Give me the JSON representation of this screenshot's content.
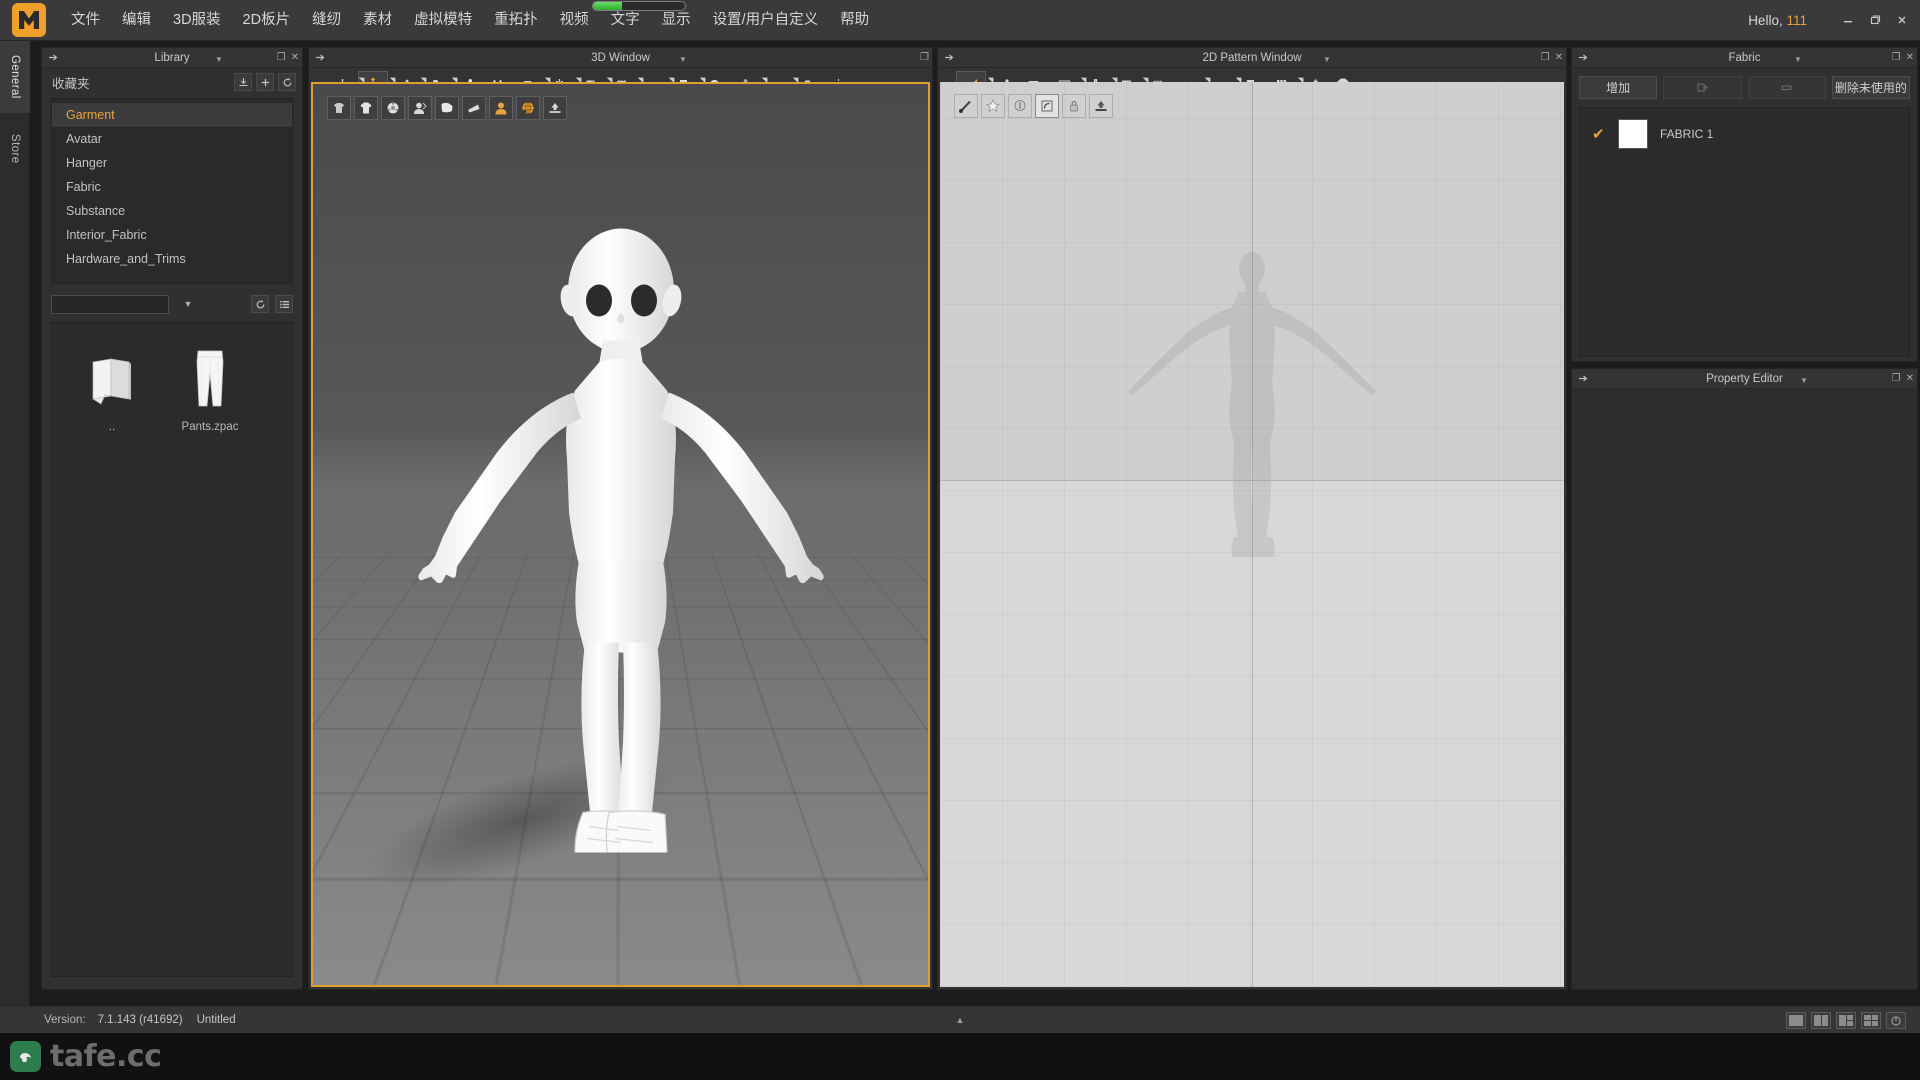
{
  "app": {
    "logo_icon": "marvelous-designer-logo",
    "greeting_label": "Hello,",
    "username": "111",
    "progress_percent": 31
  },
  "menubar": {
    "items": [
      {
        "label": "文件",
        "name": "menu-file"
      },
      {
        "label": "编辑",
        "name": "menu-edit"
      },
      {
        "label": "3D服装",
        "name": "menu-3d-garment"
      },
      {
        "label": "2D板片",
        "name": "menu-2d-pattern"
      },
      {
        "label": "缝纫",
        "name": "menu-sewing"
      },
      {
        "label": "素材",
        "name": "menu-material"
      },
      {
        "label": "虚拟模特",
        "name": "menu-avatar"
      },
      {
        "label": "重拓扑",
        "name": "menu-retopology"
      },
      {
        "label": "视频",
        "name": "menu-video"
      },
      {
        "label": "文字",
        "name": "menu-text"
      },
      {
        "label": "显示",
        "name": "menu-display"
      },
      {
        "label": "设置/用户自定义",
        "name": "menu-settings"
      },
      {
        "label": "帮助",
        "name": "menu-help"
      }
    ],
    "window_buttons": [
      "minimize",
      "restore",
      "close"
    ]
  },
  "vertical_tabs": [
    {
      "label": "General",
      "active": true
    },
    {
      "label": "Store",
      "active": false
    }
  ],
  "library": {
    "title": "Library",
    "favorites_label": "收藏夹",
    "header_icons": [
      "import-icon",
      "add-icon",
      "refresh-icon"
    ],
    "categories": [
      {
        "label": "Garment",
        "selected": true
      },
      {
        "label": "Avatar",
        "selected": false
      },
      {
        "label": "Hanger",
        "selected": false
      },
      {
        "label": "Fabric",
        "selected": false
      },
      {
        "label": "Substance",
        "selected": false
      },
      {
        "label": "Interior_Fabric",
        "selected": false
      },
      {
        "label": "Hardware_and_Trims",
        "selected": false
      }
    ],
    "search_value": "",
    "search_placeholder": "",
    "toolbar_icons": [
      "refresh-icon",
      "list-view-icon"
    ],
    "files": [
      {
        "caption": "..",
        "icon": "folder-up-icon"
      },
      {
        "caption": "Pants.zpac",
        "icon": "pants-thumbnail"
      }
    ]
  },
  "window3d": {
    "title": "3D Window",
    "toolbar": [
      {
        "name": "select-mesh-tool",
        "icon": "arrow-down",
        "active": false
      },
      {
        "name": "transform-tool",
        "icon": "move-gizmo",
        "active": true
      },
      {
        "name": "edit-pattern-tool",
        "icon": "pen-edit",
        "active": false
      },
      {
        "name": "pin-tool",
        "icon": "pin",
        "active": false
      },
      {
        "name": "tape-measure-tool",
        "icon": "measure",
        "active": false
      },
      {
        "name": "fold-arrange-tool",
        "icon": "double-arrow-up",
        "active": false
      },
      {
        "name": "flip-tool",
        "icon": "flip",
        "active": false
      },
      {
        "name": "zipper-tool",
        "icon": "zipper",
        "active": false
      },
      {
        "name": "fabric-tool",
        "icon": "fabric-swatch",
        "active": false
      },
      {
        "name": "grid-tool",
        "icon": "grid",
        "active": false
      },
      {
        "name": "stitch-tool",
        "icon": "stitch",
        "active": false
      },
      {
        "name": "puckering-tool",
        "icon": "puckering",
        "active": false
      },
      {
        "name": "button-tool",
        "icon": "button-circle",
        "active": false
      },
      {
        "name": "zipper2-tool",
        "icon": "zipper-vertical",
        "active": false
      },
      {
        "name": "attach-tool",
        "icon": "attach",
        "active": false
      },
      {
        "name": "graphic-tool",
        "icon": "graphic",
        "active": false
      },
      {
        "name": "symmetric-tool",
        "icon": "symmetry",
        "active": false
      }
    ],
    "overlay_toolbar": [
      {
        "name": "show-garment-toggle",
        "icon": "garment-icon",
        "accent": false
      },
      {
        "name": "show-texture-toggle",
        "icon": "tshirt-icon",
        "accent": false
      },
      {
        "name": "show-stitch-toggle",
        "icon": "gear-ball-icon",
        "accent": false
      },
      {
        "name": "show-avatar-toggle",
        "icon": "avatar-bust-icon",
        "accent": false
      },
      {
        "name": "show-pattern-toggle",
        "icon": "pattern-icon",
        "accent": false
      },
      {
        "name": "show-shade-toggle",
        "icon": "shade-icon",
        "accent": false
      },
      {
        "name": "avatar-head-toggle",
        "icon": "avatar-head-icon",
        "accent": true
      },
      {
        "name": "environment-toggle",
        "icon": "globe-icon",
        "accent": true
      },
      {
        "name": "export-snapshot",
        "icon": "upload-icon",
        "accent": false
      }
    ]
  },
  "window2d": {
    "title": "2D Pattern Window",
    "toolbar": [
      {
        "name": "edit-pattern-tool",
        "icon": "triangle-select",
        "active": true
      },
      {
        "name": "edit-curve-tool",
        "icon": "curve-point",
        "active": false
      },
      {
        "name": "rectangle-tool",
        "icon": "rectangle",
        "active": false
      },
      {
        "name": "polygon-tool",
        "icon": "polygon",
        "active": false
      },
      {
        "name": "pleat-tool",
        "icon": "pleat",
        "active": false
      },
      {
        "name": "internal-line-tool",
        "icon": "internal-line",
        "active": false
      },
      {
        "name": "grid-tool",
        "icon": "grid",
        "active": false
      },
      {
        "name": "dart-tool",
        "icon": "dart",
        "active": false
      },
      {
        "name": "sew-tool",
        "icon": "sew",
        "active": false
      },
      {
        "name": "puckering-tool",
        "icon": "puckering",
        "active": false
      },
      {
        "name": "pleat-fold-tool",
        "icon": "pleat-fold",
        "active": false
      },
      {
        "name": "trim-tool",
        "icon": "pencil-trim",
        "active": false
      },
      {
        "name": "garment-tool",
        "icon": "tshirt-icon",
        "active": false
      }
    ],
    "overlay_toolbar": [
      {
        "name": "pen-tool",
        "icon": "pen-icon"
      },
      {
        "name": "star-tool",
        "icon": "star-icon"
      },
      {
        "name": "circle-tool",
        "icon": "circle-icon"
      },
      {
        "name": "square-select-tool",
        "icon": "square-icon",
        "selected": true
      },
      {
        "name": "lock-tool",
        "icon": "lock-icon"
      },
      {
        "name": "export-tool",
        "icon": "upload-icon"
      }
    ]
  },
  "fabric_panel": {
    "title": "Fabric",
    "buttons": [
      {
        "label": "增加",
        "name": "add-fabric-button",
        "disabled": false
      },
      {
        "label": "",
        "name": "duplicate-fabric-button",
        "icon": "copy-icon",
        "disabled": true
      },
      {
        "label": "",
        "name": "rename-fabric-button",
        "icon": "rename-icon",
        "disabled": true
      },
      {
        "label": "删除未使用的",
        "name": "delete-unused-button",
        "disabled": false
      }
    ],
    "items": [
      {
        "name": "FABRIC 1",
        "checked": true,
        "swatch_color": "#ffffff"
      }
    ],
    "accent_color": "#e8a33d"
  },
  "property_editor": {
    "title": "Property Editor"
  },
  "statusbar": {
    "version_label": "Version:",
    "version_value": "7.1.143 (r41692)",
    "document_name": "Untitled",
    "collapse_icon": "chevron-up-icon",
    "layout_presets": [
      {
        "name": "layout-single",
        "cells": 1
      },
      {
        "name": "layout-two-column",
        "cells": 2
      },
      {
        "name": "layout-three-panel",
        "cells": 3
      },
      {
        "name": "layout-quad",
        "cells": 4
      },
      {
        "name": "layout-custom",
        "cells": 0
      }
    ]
  },
  "watermark": {
    "text": "tafe.cc",
    "logo_icon": "tafe-logo"
  }
}
